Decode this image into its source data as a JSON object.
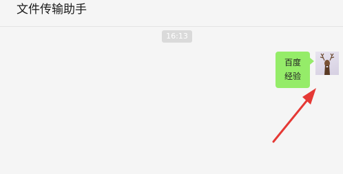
{
  "header": {
    "title": "文件传输助手"
  },
  "chat": {
    "timestamp": "16:13",
    "messages": [
      {
        "line1": "百度",
        "line2": "经验"
      }
    ]
  },
  "colors": {
    "bubble": "#95ec69",
    "arrow": "#e53935",
    "background": "#f5f5f5"
  },
  "icons": {
    "avatar": "deer-avatar-icon",
    "annotation": "red-arrow-icon"
  }
}
